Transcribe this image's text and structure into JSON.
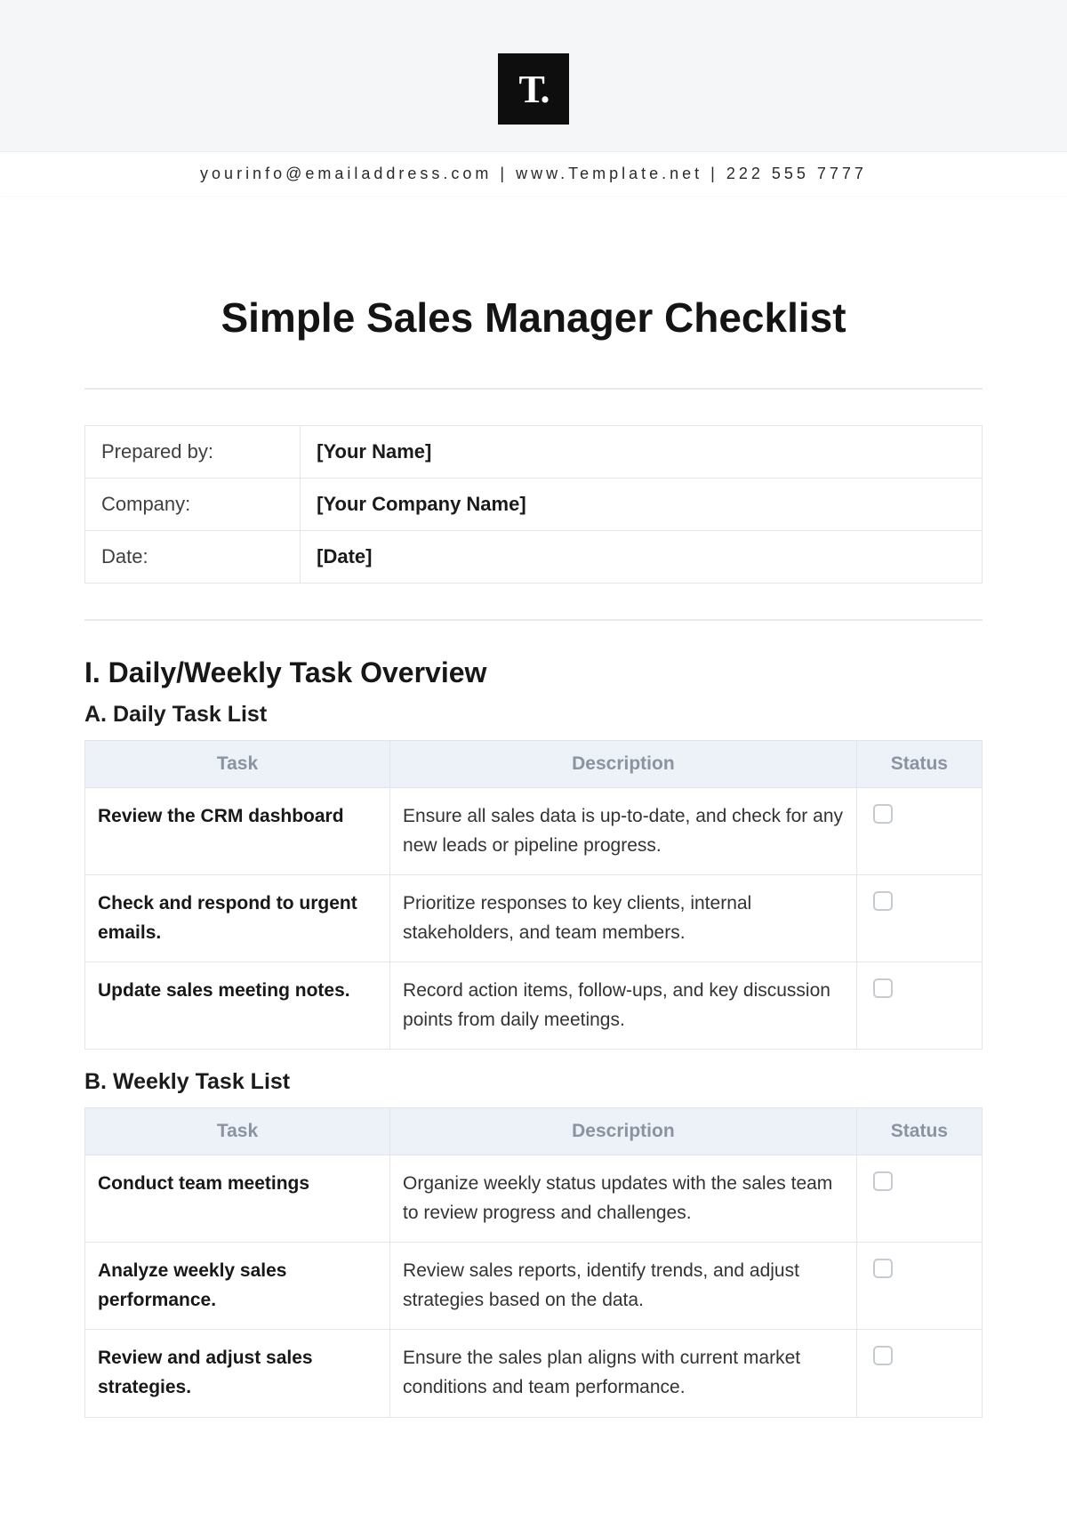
{
  "logo_text": "T.",
  "contact_line": "yourinfo@emailaddress.com | www.Template.net | 222 555 7777",
  "title": "Simple Sales Manager Checklist",
  "meta": {
    "rows": [
      {
        "label": "Prepared by:",
        "value": "[Your Name]"
      },
      {
        "label": "Company:",
        "value": "[Your Company Name]"
      },
      {
        "label": "Date:",
        "value": "[Date]"
      }
    ]
  },
  "section1": {
    "heading": "I. Daily/Weekly Task Overview",
    "daily": {
      "heading": "A. Daily Task List",
      "columns": {
        "task": "Task",
        "desc": "Description",
        "status": "Status"
      },
      "rows": [
        {
          "task": "Review the CRM dashboard",
          "desc": "Ensure all sales data is up-to-date, and check for any new leads or pipeline progress."
        },
        {
          "task": "Check and respond to urgent emails.",
          "desc": "Prioritize responses to key clients, internal stakeholders, and team members."
        },
        {
          "task": "Update sales meeting notes.",
          "desc": "Record action items, follow-ups, and key discussion points from daily meetings."
        }
      ]
    },
    "weekly": {
      "heading": "B. Weekly Task List",
      "columns": {
        "task": "Task",
        "desc": "Description",
        "status": "Status"
      },
      "rows": [
        {
          "task": "Conduct team meetings",
          "desc": "Organize weekly status updates with the sales team to review progress and challenges."
        },
        {
          "task": "Analyze weekly sales performance.",
          "desc": "Review sales reports, identify trends, and adjust strategies based on the data."
        },
        {
          "task": "Review and adjust sales strategies.",
          "desc": "Ensure the sales plan aligns with current market conditions and team performance."
        }
      ]
    }
  }
}
